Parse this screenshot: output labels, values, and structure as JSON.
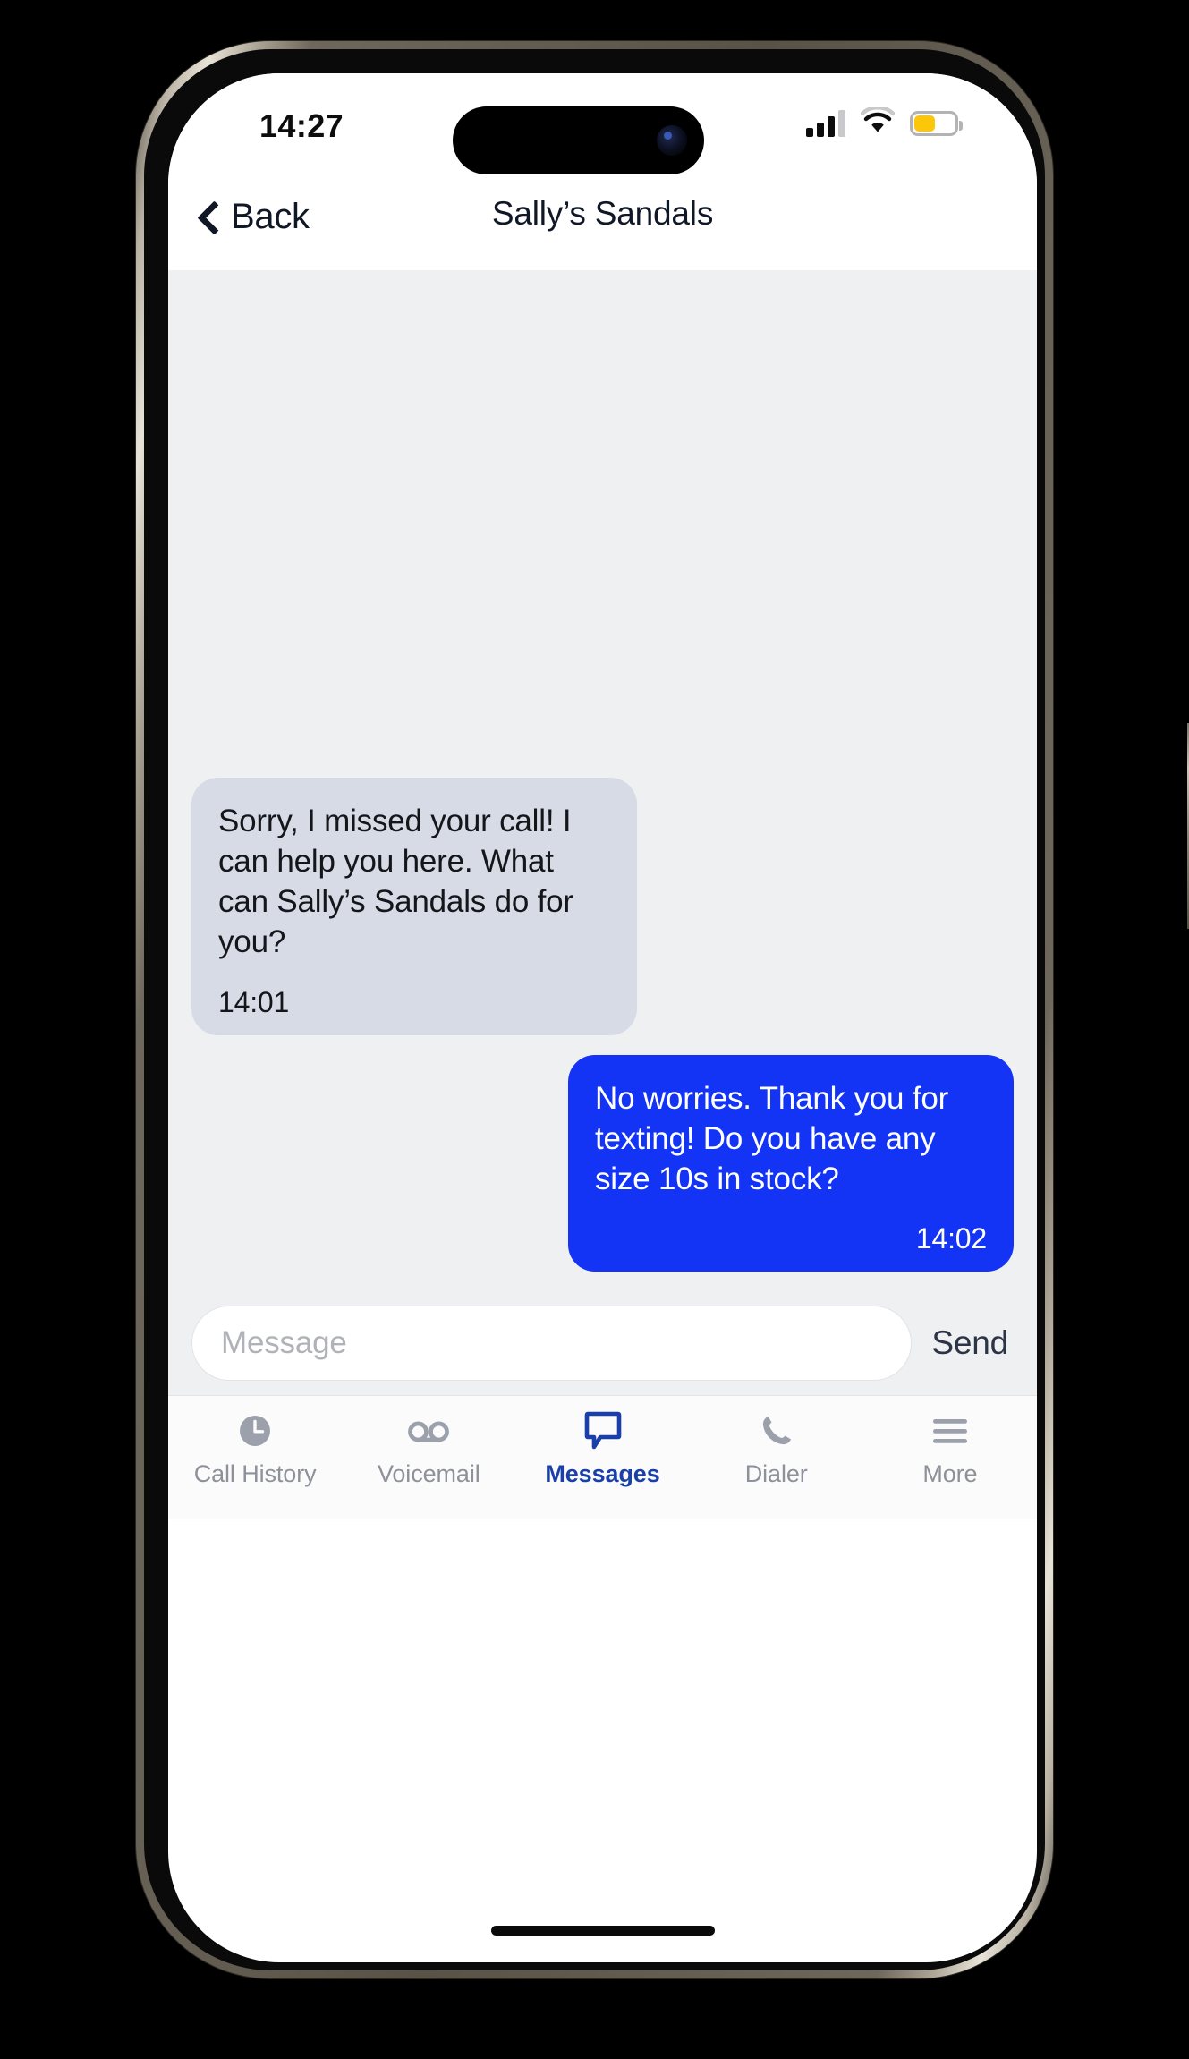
{
  "status_bar": {
    "time": "14:27",
    "signal_icon": "cellular-signal-icon",
    "signal_bars_filled": 3,
    "signal_bars_total": 4,
    "wifi_icon": "wifi-icon",
    "battery_icon": "battery-icon",
    "battery_level_percent": 48,
    "battery_color": "#fcc60a"
  },
  "nav_bar": {
    "back_label": "Back",
    "back_icon": "chevron-left-icon",
    "title": "Sally’s Sandals"
  },
  "conversation": {
    "messages": [
      {
        "direction": "incoming",
        "text": "Sorry, I missed your call! I can help you here. What can Sally’s Sandals do for you?",
        "time": "14:01",
        "bubble_color": "#d6dbe5",
        "text_color": "#14161a"
      },
      {
        "direction": "outgoing",
        "text": "No worries. Thank you for texting! Do you have any size 10s in stock?",
        "time": "14:02",
        "bubble_color": "#1434f5",
        "text_color": "#ffffff"
      }
    ]
  },
  "composer": {
    "placeholder": "Message",
    "value": "",
    "send_label": "Send"
  },
  "tab_bar": {
    "active_color": "#1a3fa8",
    "inactive_color": "#8e9199",
    "items": [
      {
        "label": "Call History",
        "icon": "clock-icon",
        "active": false
      },
      {
        "label": "Voicemail",
        "icon": "voicemail-icon",
        "active": false
      },
      {
        "label": "Messages",
        "icon": "speech-bubble-icon",
        "active": true
      },
      {
        "label": "Dialer",
        "icon": "phone-handset-icon",
        "active": false
      },
      {
        "label": "More",
        "icon": "hamburger-menu-icon",
        "active": false
      }
    ]
  }
}
